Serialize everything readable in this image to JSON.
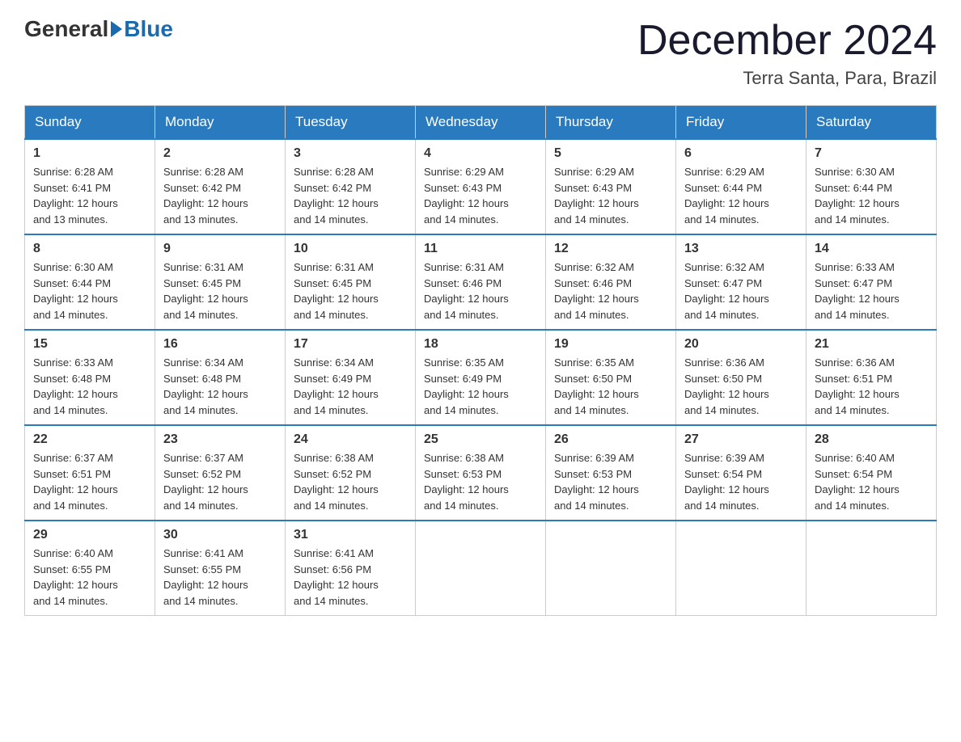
{
  "logo": {
    "general_text": "General",
    "blue_text": "Blue"
  },
  "header": {
    "title": "December 2024",
    "subtitle": "Terra Santa, Para, Brazil"
  },
  "days_of_week": [
    "Sunday",
    "Monday",
    "Tuesday",
    "Wednesday",
    "Thursday",
    "Friday",
    "Saturday"
  ],
  "weeks": [
    [
      {
        "day": "1",
        "sunrise": "6:28 AM",
        "sunset": "6:41 PM",
        "daylight": "12 hours and 13 minutes."
      },
      {
        "day": "2",
        "sunrise": "6:28 AM",
        "sunset": "6:42 PM",
        "daylight": "12 hours and 13 minutes."
      },
      {
        "day": "3",
        "sunrise": "6:28 AM",
        "sunset": "6:42 PM",
        "daylight": "12 hours and 14 minutes."
      },
      {
        "day": "4",
        "sunrise": "6:29 AM",
        "sunset": "6:43 PM",
        "daylight": "12 hours and 14 minutes."
      },
      {
        "day": "5",
        "sunrise": "6:29 AM",
        "sunset": "6:43 PM",
        "daylight": "12 hours and 14 minutes."
      },
      {
        "day": "6",
        "sunrise": "6:29 AM",
        "sunset": "6:44 PM",
        "daylight": "12 hours and 14 minutes."
      },
      {
        "day": "7",
        "sunrise": "6:30 AM",
        "sunset": "6:44 PM",
        "daylight": "12 hours and 14 minutes."
      }
    ],
    [
      {
        "day": "8",
        "sunrise": "6:30 AM",
        "sunset": "6:44 PM",
        "daylight": "12 hours and 14 minutes."
      },
      {
        "day": "9",
        "sunrise": "6:31 AM",
        "sunset": "6:45 PM",
        "daylight": "12 hours and 14 minutes."
      },
      {
        "day": "10",
        "sunrise": "6:31 AM",
        "sunset": "6:45 PM",
        "daylight": "12 hours and 14 minutes."
      },
      {
        "day": "11",
        "sunrise": "6:31 AM",
        "sunset": "6:46 PM",
        "daylight": "12 hours and 14 minutes."
      },
      {
        "day": "12",
        "sunrise": "6:32 AM",
        "sunset": "6:46 PM",
        "daylight": "12 hours and 14 minutes."
      },
      {
        "day": "13",
        "sunrise": "6:32 AM",
        "sunset": "6:47 PM",
        "daylight": "12 hours and 14 minutes."
      },
      {
        "day": "14",
        "sunrise": "6:33 AM",
        "sunset": "6:47 PM",
        "daylight": "12 hours and 14 minutes."
      }
    ],
    [
      {
        "day": "15",
        "sunrise": "6:33 AM",
        "sunset": "6:48 PM",
        "daylight": "12 hours and 14 minutes."
      },
      {
        "day": "16",
        "sunrise": "6:34 AM",
        "sunset": "6:48 PM",
        "daylight": "12 hours and 14 minutes."
      },
      {
        "day": "17",
        "sunrise": "6:34 AM",
        "sunset": "6:49 PM",
        "daylight": "12 hours and 14 minutes."
      },
      {
        "day": "18",
        "sunrise": "6:35 AM",
        "sunset": "6:49 PM",
        "daylight": "12 hours and 14 minutes."
      },
      {
        "day": "19",
        "sunrise": "6:35 AM",
        "sunset": "6:50 PM",
        "daylight": "12 hours and 14 minutes."
      },
      {
        "day": "20",
        "sunrise": "6:36 AM",
        "sunset": "6:50 PM",
        "daylight": "12 hours and 14 minutes."
      },
      {
        "day": "21",
        "sunrise": "6:36 AM",
        "sunset": "6:51 PM",
        "daylight": "12 hours and 14 minutes."
      }
    ],
    [
      {
        "day": "22",
        "sunrise": "6:37 AM",
        "sunset": "6:51 PM",
        "daylight": "12 hours and 14 minutes."
      },
      {
        "day": "23",
        "sunrise": "6:37 AM",
        "sunset": "6:52 PM",
        "daylight": "12 hours and 14 minutes."
      },
      {
        "day": "24",
        "sunrise": "6:38 AM",
        "sunset": "6:52 PM",
        "daylight": "12 hours and 14 minutes."
      },
      {
        "day": "25",
        "sunrise": "6:38 AM",
        "sunset": "6:53 PM",
        "daylight": "12 hours and 14 minutes."
      },
      {
        "day": "26",
        "sunrise": "6:39 AM",
        "sunset": "6:53 PM",
        "daylight": "12 hours and 14 minutes."
      },
      {
        "day": "27",
        "sunrise": "6:39 AM",
        "sunset": "6:54 PM",
        "daylight": "12 hours and 14 minutes."
      },
      {
        "day": "28",
        "sunrise": "6:40 AM",
        "sunset": "6:54 PM",
        "daylight": "12 hours and 14 minutes."
      }
    ],
    [
      {
        "day": "29",
        "sunrise": "6:40 AM",
        "sunset": "6:55 PM",
        "daylight": "12 hours and 14 minutes."
      },
      {
        "day": "30",
        "sunrise": "6:41 AM",
        "sunset": "6:55 PM",
        "daylight": "12 hours and 14 minutes."
      },
      {
        "day": "31",
        "sunrise": "6:41 AM",
        "sunset": "6:56 PM",
        "daylight": "12 hours and 14 minutes."
      },
      null,
      null,
      null,
      null
    ]
  ],
  "labels": {
    "sunrise": "Sunrise:",
    "sunset": "Sunset:",
    "daylight": "Daylight:"
  }
}
